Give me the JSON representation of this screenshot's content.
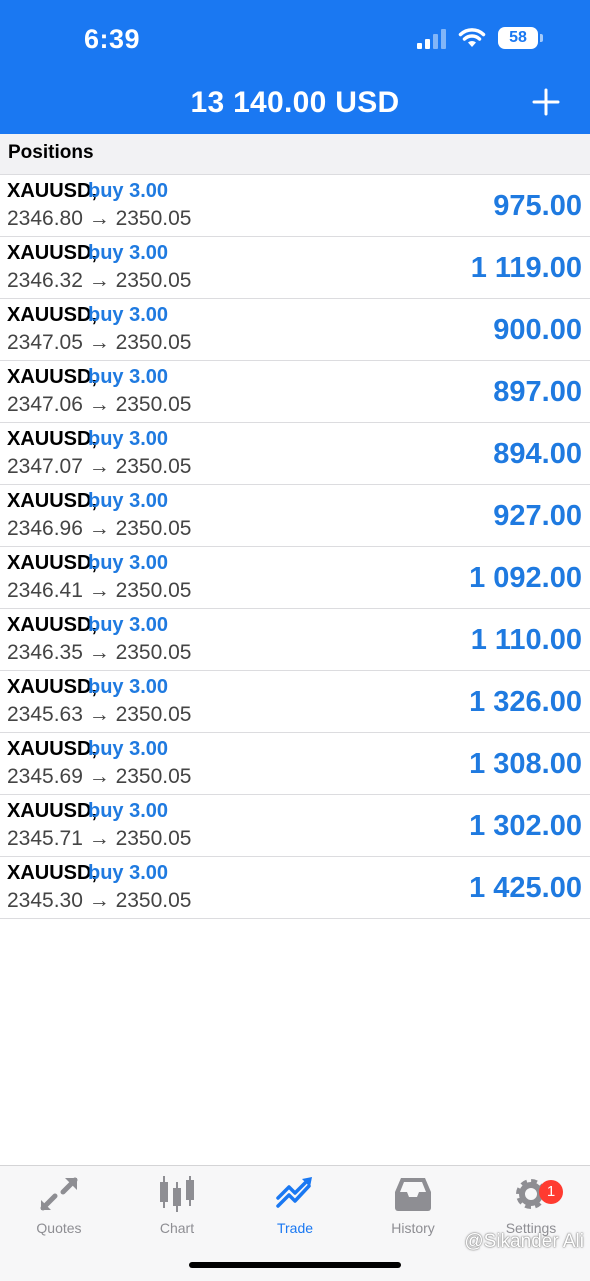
{
  "status_bar": {
    "time": "6:39",
    "battery": "58"
  },
  "header": {
    "balance": "13 140.00 USD"
  },
  "section": {
    "title": "Positions"
  },
  "positions": [
    {
      "symbol": "XAUUSD,",
      "side": "buy 3.00",
      "prices": "2346.80 → 2350.05",
      "profit": "975.00"
    },
    {
      "symbol": "XAUUSD,",
      "side": "buy 3.00",
      "prices": "2346.32 → 2350.05",
      "profit": "1 119.00"
    },
    {
      "symbol": "XAUUSD,",
      "side": "buy 3.00",
      "prices": "2347.05 → 2350.05",
      "profit": "900.00"
    },
    {
      "symbol": "XAUUSD,",
      "side": "buy 3.00",
      "prices": "2347.06 → 2350.05",
      "profit": "897.00"
    },
    {
      "symbol": "XAUUSD,",
      "side": "buy 3.00",
      "prices": "2347.07 → 2350.05",
      "profit": "894.00"
    },
    {
      "symbol": "XAUUSD,",
      "side": "buy 3.00",
      "prices": "2346.96 → 2350.05",
      "profit": "927.00"
    },
    {
      "symbol": "XAUUSD,",
      "side": "buy 3.00",
      "prices": "2346.41 → 2350.05",
      "profit": "1 092.00"
    },
    {
      "symbol": "XAUUSD,",
      "side": "buy 3.00",
      "prices": "2346.35 → 2350.05",
      "profit": "1 110.00"
    },
    {
      "symbol": "XAUUSD,",
      "side": "buy 3.00",
      "prices": "2345.63 → 2350.05",
      "profit": "1 326.00"
    },
    {
      "symbol": "XAUUSD,",
      "side": "buy 3.00",
      "prices": "2345.69 → 2350.05",
      "profit": "1 308.00"
    },
    {
      "symbol": "XAUUSD,",
      "side": "buy 3.00",
      "prices": "2345.71 → 2350.05",
      "profit": "1 302.00"
    },
    {
      "symbol": "XAUUSD,",
      "side": "buy 3.00",
      "prices": "2345.30 → 2350.05",
      "profit": "1 425.00"
    }
  ],
  "tabs": [
    {
      "label": "Quotes",
      "icon": "quotes-icon"
    },
    {
      "label": "Chart",
      "icon": "chart-icon"
    },
    {
      "label": "Trade",
      "icon": "trade-icon",
      "active": true
    },
    {
      "label": "History",
      "icon": "history-icon"
    },
    {
      "label": "Settings",
      "icon": "settings-icon",
      "badge": "1"
    }
  ],
  "watermark": "@Sikander Ali",
  "colors": {
    "accent": "#1a78f2",
    "profit": "#1f7ae0",
    "badge": "#ff3b30"
  }
}
